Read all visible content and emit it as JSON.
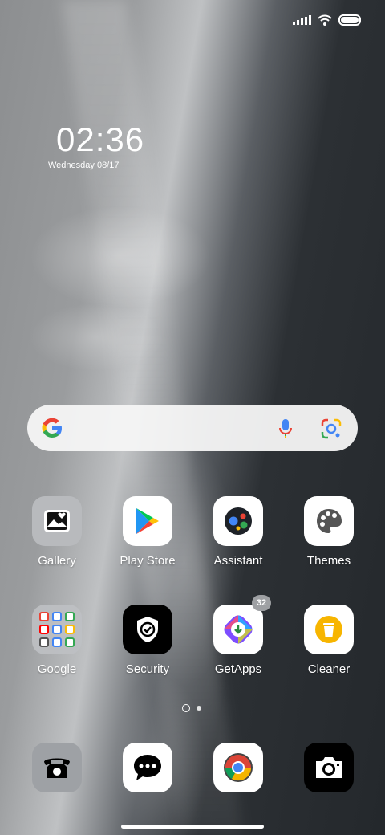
{
  "clock": {
    "time": "02:36",
    "date": "Wednesday  08/17"
  },
  "search": {
    "engine_icon": "google-g-icon",
    "mic_icon": "mic-icon",
    "lens_icon": "lens-icon"
  },
  "apps": [
    {
      "label": "Gallery",
      "icon": "gallery-icon"
    },
    {
      "label": "Play Store",
      "icon": "play-store-icon"
    },
    {
      "label": "Assistant",
      "icon": "assistant-icon"
    },
    {
      "label": "Themes",
      "icon": "palette-icon"
    },
    {
      "label": "Google",
      "icon": "folder-icon"
    },
    {
      "label": "Security",
      "icon": "shield-icon"
    },
    {
      "label": "GetApps",
      "icon": "getapps-icon",
      "badge": "32"
    },
    {
      "label": "Cleaner",
      "icon": "trash-icon"
    }
  ],
  "dock": [
    {
      "icon": "phone-icon"
    },
    {
      "icon": "messages-icon"
    },
    {
      "icon": "chrome-icon"
    },
    {
      "icon": "camera-icon"
    }
  ],
  "pager": {
    "pages": 2,
    "current": 1
  }
}
